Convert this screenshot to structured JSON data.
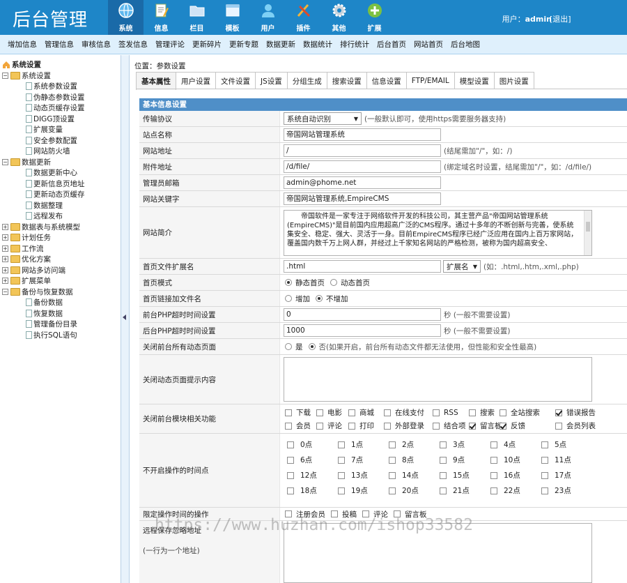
{
  "header": {
    "logo": "后台管理",
    "nav": [
      {
        "label": "系统",
        "icon": "globe-icon"
      },
      {
        "label": "信息",
        "icon": "document-icon"
      },
      {
        "label": "栏目",
        "icon": "folder-icon"
      },
      {
        "label": "模板",
        "icon": "window-icon"
      },
      {
        "label": "用户",
        "icon": "user-icon"
      },
      {
        "label": "插件",
        "icon": "tools-icon"
      },
      {
        "label": "其他",
        "icon": "gear-icon"
      },
      {
        "label": "扩展",
        "icon": "plus-icon"
      }
    ],
    "user_prefix": "用户：",
    "user_name": "admin",
    "logout": "[退出]"
  },
  "subnav": [
    "增加信息",
    "管理信息",
    "审核信息",
    "签发信息",
    "管理评论",
    "更新碎片",
    "更新专题",
    "数据更新",
    "数据统计",
    "排行统计",
    "后台首页",
    "网站首页",
    "后台地图"
  ],
  "sidebar": {
    "root": "系统设置",
    "groups": [
      {
        "label": "系统设置",
        "open": true,
        "children": [
          "系统参数设置",
          "伪静态参数设置",
          "动态页缓存设置",
          "DIGG顶设置",
          "扩展变量",
          "安全参数配置",
          "网站防火墙"
        ]
      },
      {
        "label": "数据更新",
        "open": true,
        "children": [
          "数据更新中心",
          "更新信息页地址",
          "更新动态页缓存",
          "数据整理",
          "远程发布"
        ]
      },
      {
        "label": "数据表与系统模型",
        "open": false,
        "children": []
      },
      {
        "label": "计划任务",
        "open": false,
        "children": []
      },
      {
        "label": "工作流",
        "open": false,
        "children": []
      },
      {
        "label": "优化方案",
        "open": false,
        "children": []
      },
      {
        "label": "网站多访问端",
        "open": false,
        "children": []
      },
      {
        "label": "扩展菜单",
        "open": false,
        "children": []
      },
      {
        "label": "备份与恢复数据",
        "open": true,
        "children": [
          "备份数据",
          "恢复数据",
          "管理备份目录",
          "执行SQL语句"
        ]
      }
    ]
  },
  "main": {
    "position": "位置：参数设置",
    "tabs": [
      "基本属性",
      "用户设置",
      "文件设置",
      "JS设置",
      "分组生成",
      "搜索设置",
      "信息设置",
      "FTP/EMAIL",
      "模型设置",
      "图片设置"
    ],
    "form_title": "基本信息设置",
    "fields": {
      "protocol_label": "传输协议",
      "protocol_value": "系统自动识别",
      "protocol_hint": "(一般默认即可，使用https需要服务器支持)",
      "sitename_label": "站点名称",
      "sitename_value": "帝国网站管理系统",
      "siteurl_label": "网站地址",
      "siteurl_value": "/",
      "siteurl_hint": "(结尾需加\"/\"，如：/)",
      "fileurl_label": "附件地址",
      "fileurl_value": "/d/file/",
      "fileurl_hint": "(绑定域名时设置，结尾需加\"/\"，如：/d/file/)",
      "email_label": "管理员邮箱",
      "email_value": "admin@phome.net",
      "keywords_label": "网站关键字",
      "keywords_value": "帝国网站管理系统,EmpireCMS",
      "intro_label": "网站简介",
      "intro_value": "　　帝国软件是一家专注于网络软件开发的科技公司，其主营产品\"帝国网站管理系统(EmpireCMS)\"是目前国内应用超高广泛的CMS程序。通过十多年的不断创新与完善，使系统集安全、稳定、强大、灵活于一身。目前EmpireCMS程序已经广泛应用在国内上百万家网站，覆盖国内数千万上网人群，并经过上千家知名网站的严格检测，被称为国内超高安全、",
      "ext_label": "首页文件扩展名",
      "ext_value": ".html",
      "ext_select": "扩展名",
      "ext_hint": "(如：.html,.htm,.xml,.php)",
      "mode_label": "首页模式",
      "mode_static": "静态首页",
      "mode_dynamic": "动态首页",
      "link_label": "首页链接加文件名",
      "link_add": "增加",
      "link_noadd": "不增加",
      "front_timeout_label": "前台PHP超时时间设置",
      "front_timeout_value": "0",
      "back_timeout_label": "后台PHP超时时间设置",
      "back_timeout_value": "1000",
      "timeout_hint": "秒 (一般不需要设置)",
      "close_label": "关闭前台所有动态页面",
      "close_yes": "是",
      "close_no": "否(如果开启，前台所有动态文件都无法使用，但性能和安全性最高)",
      "close_tip_label": "关闭动态页面提示内容",
      "modules_label": "关闭前台模块相关功能",
      "modules": [
        {
          "name": "下载",
          "checked": false
        },
        {
          "name": "电影",
          "checked": false
        },
        {
          "name": "商城",
          "checked": false
        },
        {
          "name": "在线支付",
          "checked": false
        },
        {
          "name": "RSS",
          "checked": false
        },
        {
          "name": "搜索",
          "checked": false
        },
        {
          "name": "全站搜索",
          "checked": false
        },
        {
          "name": "错误报告",
          "checked": true
        },
        {
          "name": "会员",
          "checked": false
        },
        {
          "name": "评论",
          "checked": false
        },
        {
          "name": "打印",
          "checked": false
        },
        {
          "name": "外部登录",
          "checked": false
        },
        {
          "name": "结合项",
          "checked": false
        },
        {
          "name": "留言板",
          "checked": true
        },
        {
          "name": "反馈",
          "checked": true
        },
        {
          "name": "会员列表",
          "checked": false
        }
      ],
      "hours_label": "不开启操作的时间点",
      "hours": [
        "0点",
        "1点",
        "2点",
        "3点",
        "4点",
        "5点",
        "6点",
        "7点",
        "8点",
        "9点",
        "10点",
        "11点",
        "12点",
        "13点",
        "14点",
        "15点",
        "16点",
        "17点",
        "18点",
        "19点",
        "20点",
        "21点",
        "22点",
        "23点"
      ],
      "limit_label": "限定操作时间的操作",
      "limit_ops": [
        "注册会员",
        "投稿",
        "评论",
        "留言板"
      ],
      "remote_label": "远程保存忽略地址",
      "remote_hint": "(一行为一个地址)"
    }
  },
  "watermark": "https://www.huzhan.com/ishop33582",
  "colors": {
    "header": "#1e86c8",
    "subnav": "#dff0fc",
    "form_title": "#4f8fc8"
  }
}
